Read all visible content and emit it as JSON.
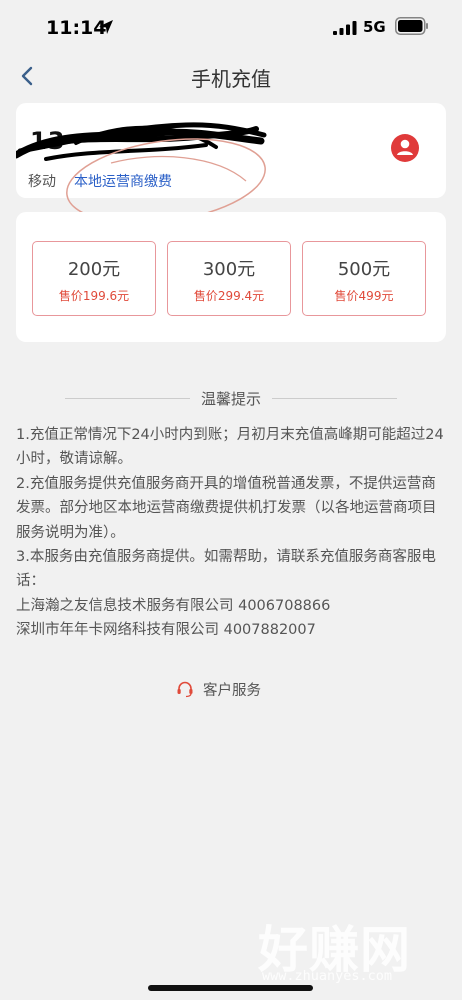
{
  "status_bar": {
    "time": "11:14",
    "network": "5G"
  },
  "nav": {
    "title": "手机充值",
    "back_icon": "chevron-left-icon"
  },
  "account": {
    "phone_number": "13",
    "carrier": "移动",
    "payment_type": "本地运营商缴费",
    "contact_icon": "contact-person-icon"
  },
  "amounts": [
    {
      "value": "200元",
      "price": "售价199.6元"
    },
    {
      "value": "300元",
      "price": "售价299.4元"
    },
    {
      "value": "500元",
      "price": "售价499元"
    }
  ],
  "tips": {
    "heading": "温馨提示",
    "lines": [
      "1.充值正常情况下24小时内到账；月初月末充值高峰期可能超过24小时，敬请谅解。",
      "2.充值服务提供充值服务商开具的增值税普通发票，不提供运营商发票。部分地区本地运营商缴费提供机打发票（以各地运营商项目服务说明为准）。",
      "3.本服务由充值服务商提供。如需帮助，请联系充值服务商客服电话：",
      "上海瀚之友信息技术服务有限公司 4006708866",
      "深圳市年年卡网络科技有限公司 4007882007"
    ]
  },
  "service": {
    "label": "客户服务",
    "icon": "headset-icon"
  },
  "watermark": {
    "text": "好赚网",
    "url": "www.zhuanyes.com"
  },
  "colors": {
    "accent": "#e04a3a",
    "link": "#2a5fc7",
    "border": "#e8979b"
  }
}
